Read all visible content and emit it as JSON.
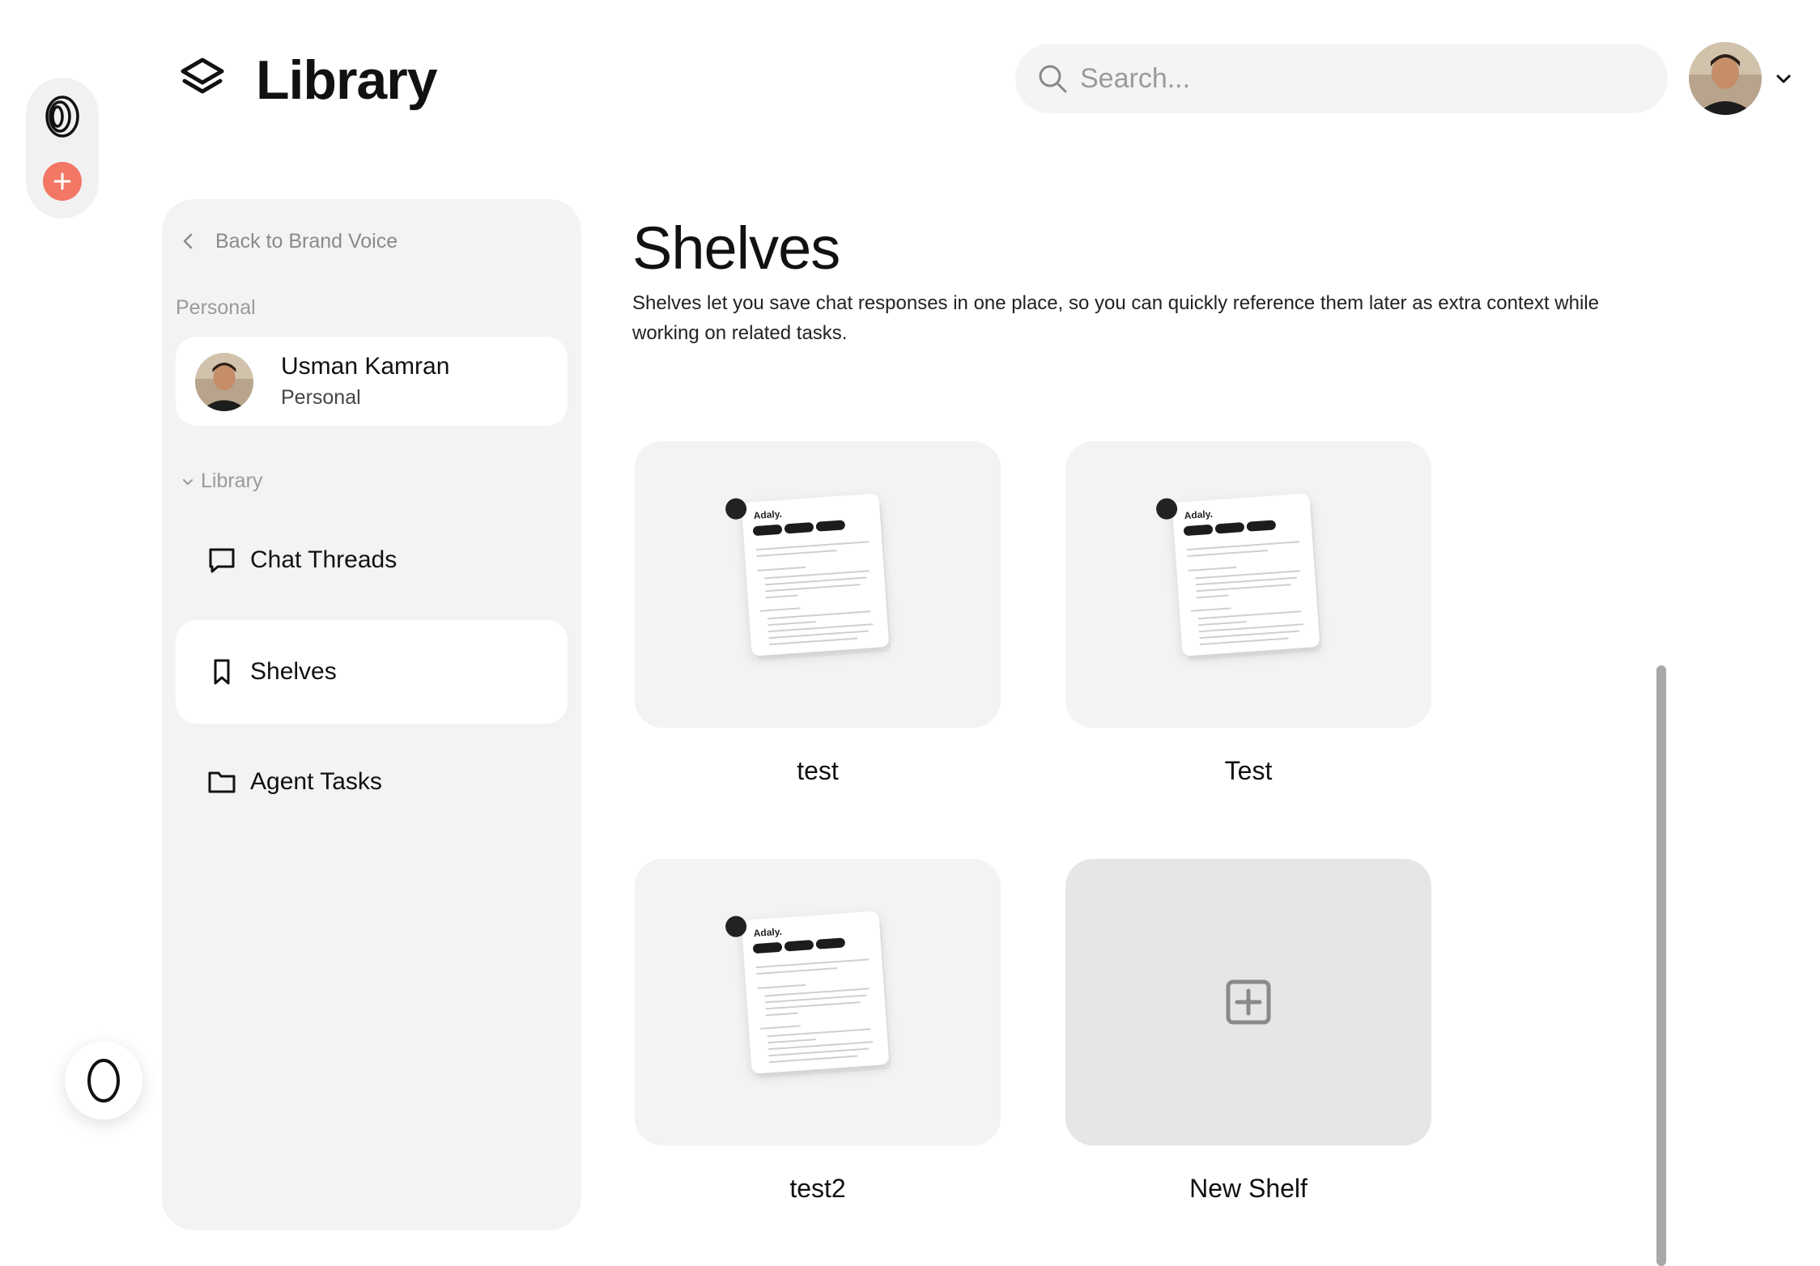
{
  "header": {
    "title": "Library",
    "search_placeholder": "Search..."
  },
  "sidebar": {
    "back_label": "Back to Brand Voice",
    "personal_section": "Personal",
    "user": {
      "name": "Usman Kamran",
      "subtitle": "Personal"
    },
    "library_section": "Library",
    "items": [
      {
        "label": "Chat Threads",
        "icon": "chat-bubble-icon",
        "active": false
      },
      {
        "label": "Shelves",
        "icon": "bookmark-icon",
        "active": true
      },
      {
        "label": "Agent Tasks",
        "icon": "folder-icon",
        "active": false
      }
    ]
  },
  "main": {
    "title": "Shelves",
    "description": "Shelves let you save chat responses in one place, so you can quickly reference them later as extra context while working on related tasks.",
    "shelves": [
      {
        "label": "test"
      },
      {
        "label": "Test"
      },
      {
        "label": "test2"
      }
    ],
    "new_shelf_label": "New Shelf",
    "thumbnail": {
      "title": "Adaly."
    }
  },
  "colors": {
    "accent": "#f27765",
    "panel": "#f3f3f3",
    "card": "#f3f3f3",
    "new_card": "#e6e6e6"
  }
}
